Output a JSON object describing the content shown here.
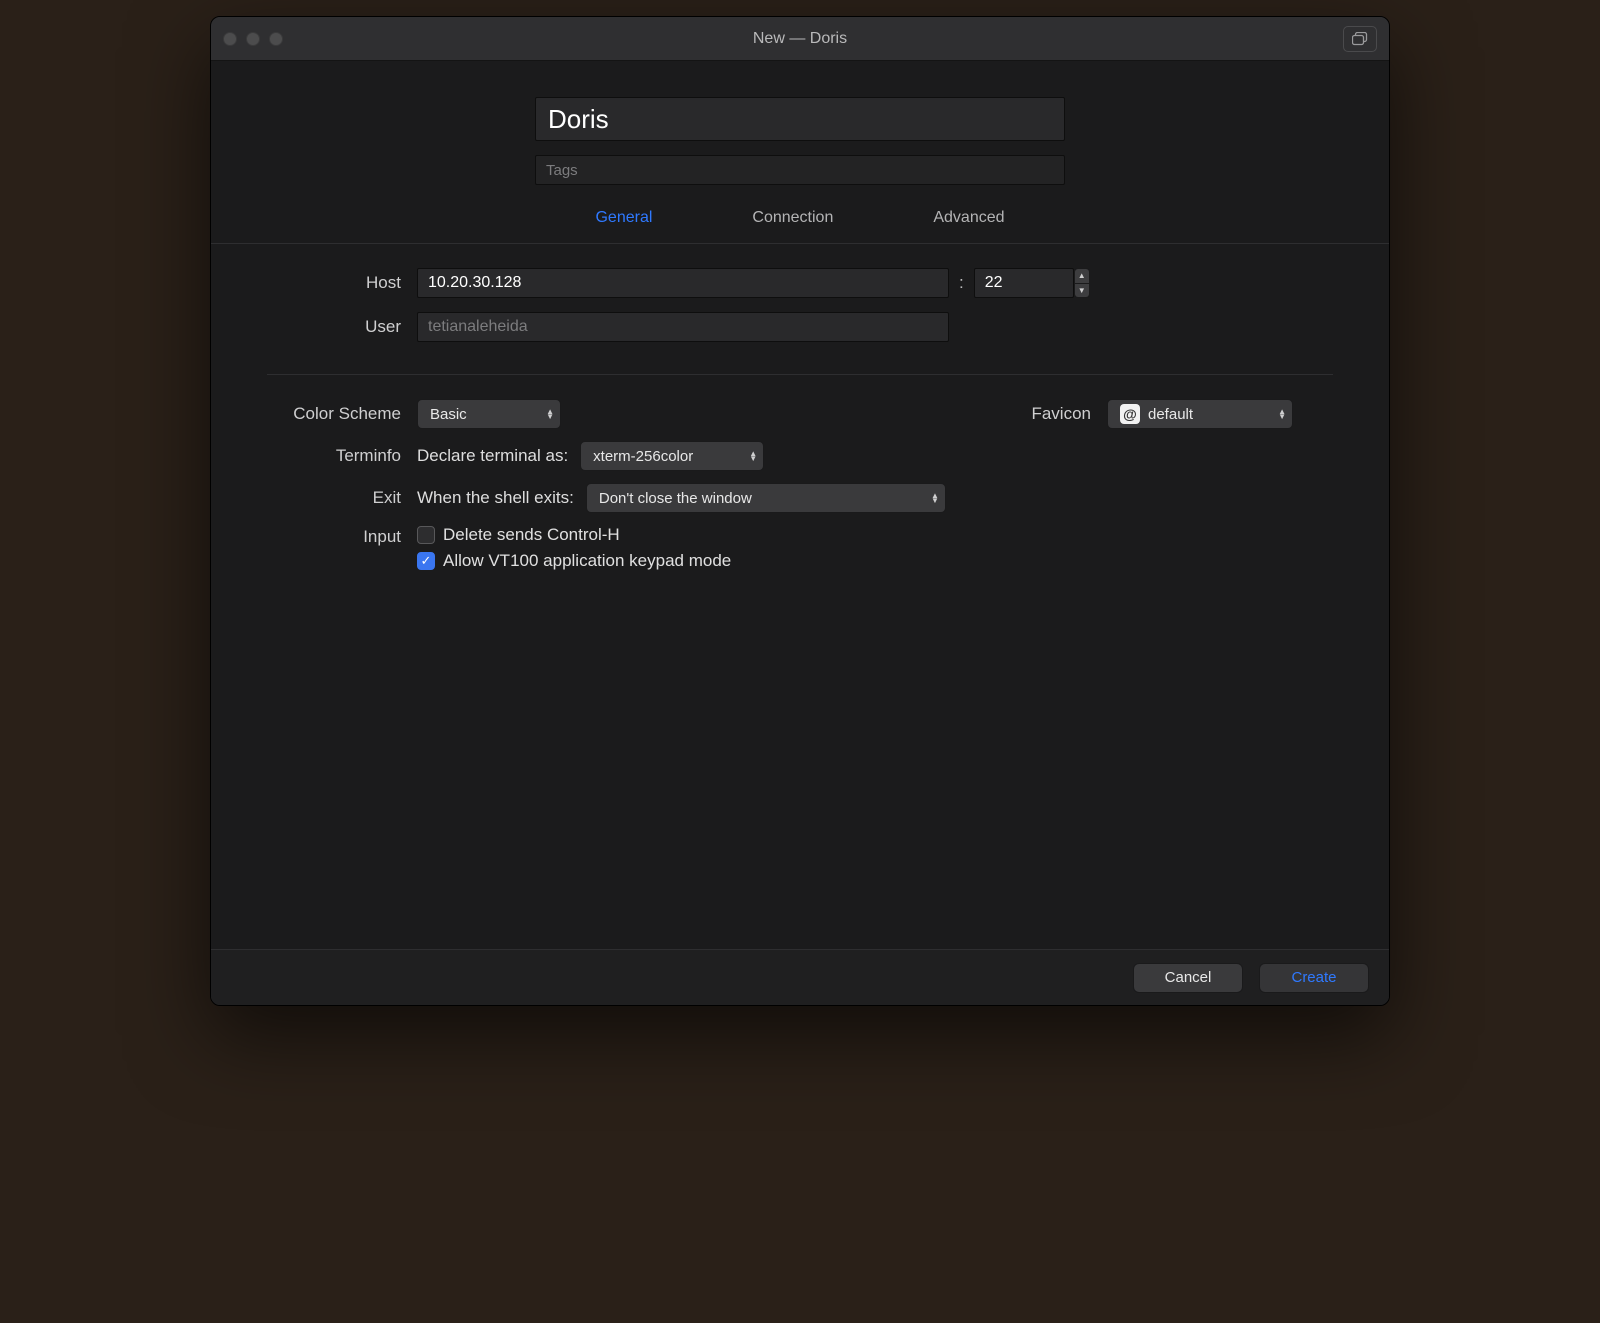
{
  "window": {
    "title": "New — Doris"
  },
  "header": {
    "name_value": "Doris",
    "tags_placeholder": "Tags"
  },
  "tabs": [
    {
      "label": "General",
      "active": true
    },
    {
      "label": "Connection",
      "active": false
    },
    {
      "label": "Advanced",
      "active": false
    }
  ],
  "connection": {
    "host_label": "Host",
    "host_value": "10.20.30.128",
    "port_value": "22",
    "port_separator": ":",
    "user_label": "User",
    "user_placeholder": "tetianaleheida"
  },
  "settings": {
    "color_scheme_label": "Color Scheme",
    "color_scheme_value": "Basic",
    "favicon_label": "Favicon",
    "favicon_badge": "@",
    "favicon_value": "default",
    "terminfo_label": "Terminfo",
    "terminfo_text": "Declare terminal as:",
    "terminfo_value": "xterm-256color",
    "exit_label": "Exit",
    "exit_text": "When the shell exits:",
    "exit_value": "Don't close the window",
    "input_label": "Input",
    "delete_ctrl_h_label": "Delete sends Control-H",
    "delete_ctrl_h_checked": false,
    "vt100_label": "Allow VT100 application keypad mode",
    "vt100_checked": true
  },
  "footer": {
    "cancel": "Cancel",
    "create": "Create"
  }
}
